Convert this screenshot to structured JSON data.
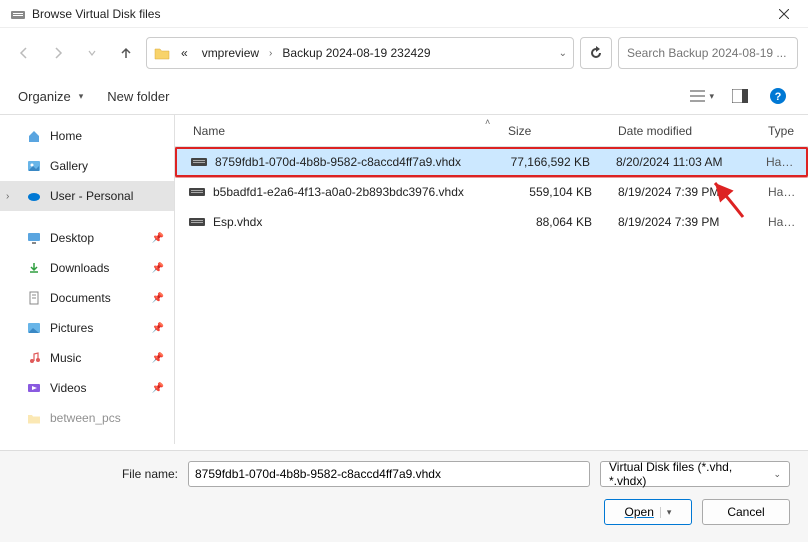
{
  "window": {
    "title": "Browse Virtual Disk files"
  },
  "breadcrumb": {
    "seg0": "«",
    "seg1": "vmpreview",
    "seg2": "Backup 2024-08-19 232429"
  },
  "search": {
    "placeholder": "Search Backup 2024-08-19 ..."
  },
  "toolbar": {
    "organize": "Organize",
    "newfolder": "New folder"
  },
  "sidebar": {
    "home": "Home",
    "gallery": "Gallery",
    "user": "User - Personal",
    "desktop": "Desktop",
    "downloads": "Downloads",
    "documents": "Documents",
    "pictures": "Pictures",
    "music": "Music",
    "videos": "Videos",
    "between": "between_pcs"
  },
  "columns": {
    "name": "Name",
    "size": "Size",
    "date": "Date modified",
    "type": "Type"
  },
  "files": [
    {
      "name": "8759fdb1-070d-4b8b-9582-c8accd4ff7a9.vhdx",
      "size": "77,166,592 KB",
      "date": "8/20/2024 11:03 AM",
      "type": "Hard D",
      "selected": true
    },
    {
      "name": "b5badfd1-e2a6-4f13-a0a0-2b893bdc3976.vhdx",
      "size": "559,104 KB",
      "date": "8/19/2024 7:39 PM",
      "type": "Hard D",
      "selected": false
    },
    {
      "name": "Esp.vhdx",
      "size": "88,064 KB",
      "date": "8/19/2024 7:39 PM",
      "type": "Hard D",
      "selected": false
    }
  ],
  "bottom": {
    "filelabel": "File name:",
    "filename": "8759fdb1-070d-4b8b-9582-c8accd4ff7a9.vhdx",
    "filter": "Virtual Disk files (*.vhd, *.vhdx)",
    "open": "Open",
    "cancel": "Cancel"
  }
}
